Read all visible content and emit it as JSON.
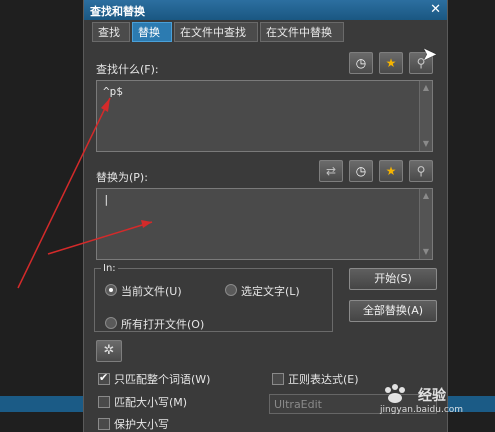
{
  "dialog": {
    "title": "查找和替换",
    "close_glyph": "✕"
  },
  "tabs": [
    {
      "label": "查找",
      "active": false
    },
    {
      "label": "替换",
      "active": true
    },
    {
      "label": "在文件中查找",
      "active": false
    },
    {
      "label": "在文件中替换",
      "active": false
    }
  ],
  "find": {
    "label": "查找什么(F):",
    "value": "^p$"
  },
  "replace": {
    "label": "替换为(P):",
    "value": "|"
  },
  "scope": {
    "group_label": "In:",
    "options": [
      {
        "label": "当前文件(U)",
        "selected": true
      },
      {
        "label": "选定文字(L)",
        "selected": false
      },
      {
        "label": "所有打开文件(O)",
        "selected": false
      }
    ]
  },
  "buttons": {
    "start": "开始(S)",
    "replace_all": "全部替换(A)"
  },
  "options": [
    {
      "label": "只匹配整个词语(W)",
      "checked": true
    },
    {
      "label": "正则表达式(E)",
      "checked": false
    },
    {
      "label": "匹配大小写(M)",
      "checked": false
    },
    {
      "label": "保护大小写",
      "checked": false
    }
  ],
  "regex_engine": {
    "value": "UltraEdit"
  },
  "watermark": {
    "brand": "经验",
    "url": "jingyan.baidu.com"
  },
  "icons": {
    "history": "clock-icon",
    "favorites": "star-icon",
    "find_in": "magnifier-icon",
    "swap": "swap-icon",
    "settings": "gear-icon"
  },
  "colors": {
    "accent": "#2c7bb1",
    "titlebar": "#1a5782",
    "annotation": "#d42a2a",
    "background": "#3a3a3a"
  }
}
